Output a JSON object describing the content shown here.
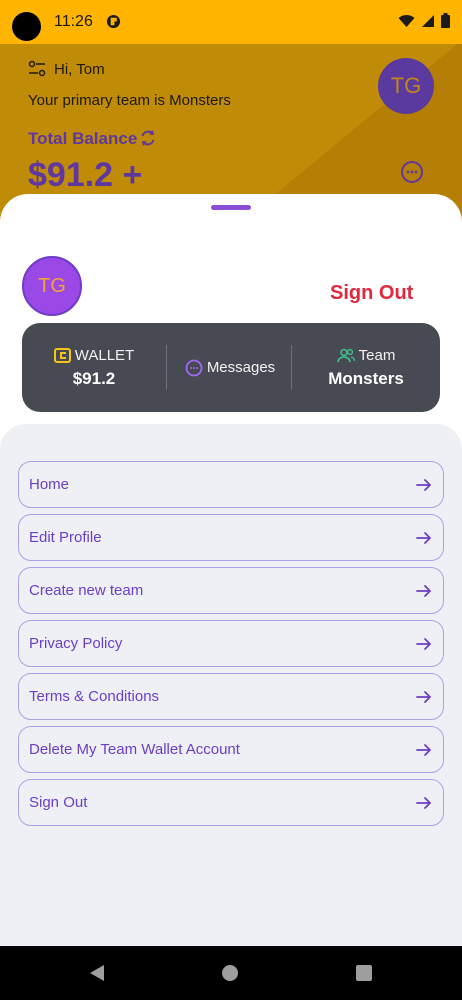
{
  "status_bar": {
    "time": "11:26"
  },
  "header": {
    "greeting": "Hi, Tom",
    "primary_team": "Your primary team is Monsters",
    "avatar_initials": "TG",
    "total_balance_label": "Total Balance",
    "balance_amount": "$91.2 +"
  },
  "sheet": {
    "avatar_initials": "TG",
    "sign_out_label": "Sign Out",
    "summary": {
      "wallet_label": "WALLET",
      "wallet_value": "$91.2",
      "messages_label": "Messages",
      "team_label": "Team",
      "team_value": "Monsters"
    },
    "menu": [
      {
        "label": "Home"
      },
      {
        "label": "Edit Profile"
      },
      {
        "label": "Create new team"
      },
      {
        "label": "Privacy Policy"
      },
      {
        "label": "Terms & Conditions"
      },
      {
        "label": "Delete My Team Wallet Account"
      },
      {
        "label": "Sign Out"
      }
    ]
  },
  "colors": {
    "accent": "#6b3fc6",
    "status_bar": "#ffb400",
    "danger": "#e2283c",
    "card": "#474a52"
  },
  "icons": [
    "filter-icon",
    "refresh-icon",
    "chat-icon",
    "wallet-icon",
    "messages-icon",
    "team-icon",
    "arrow-right-icon",
    "wifi-icon",
    "signal-icon",
    "battery-icon",
    "back-icon",
    "home-icon",
    "recents-icon"
  ]
}
